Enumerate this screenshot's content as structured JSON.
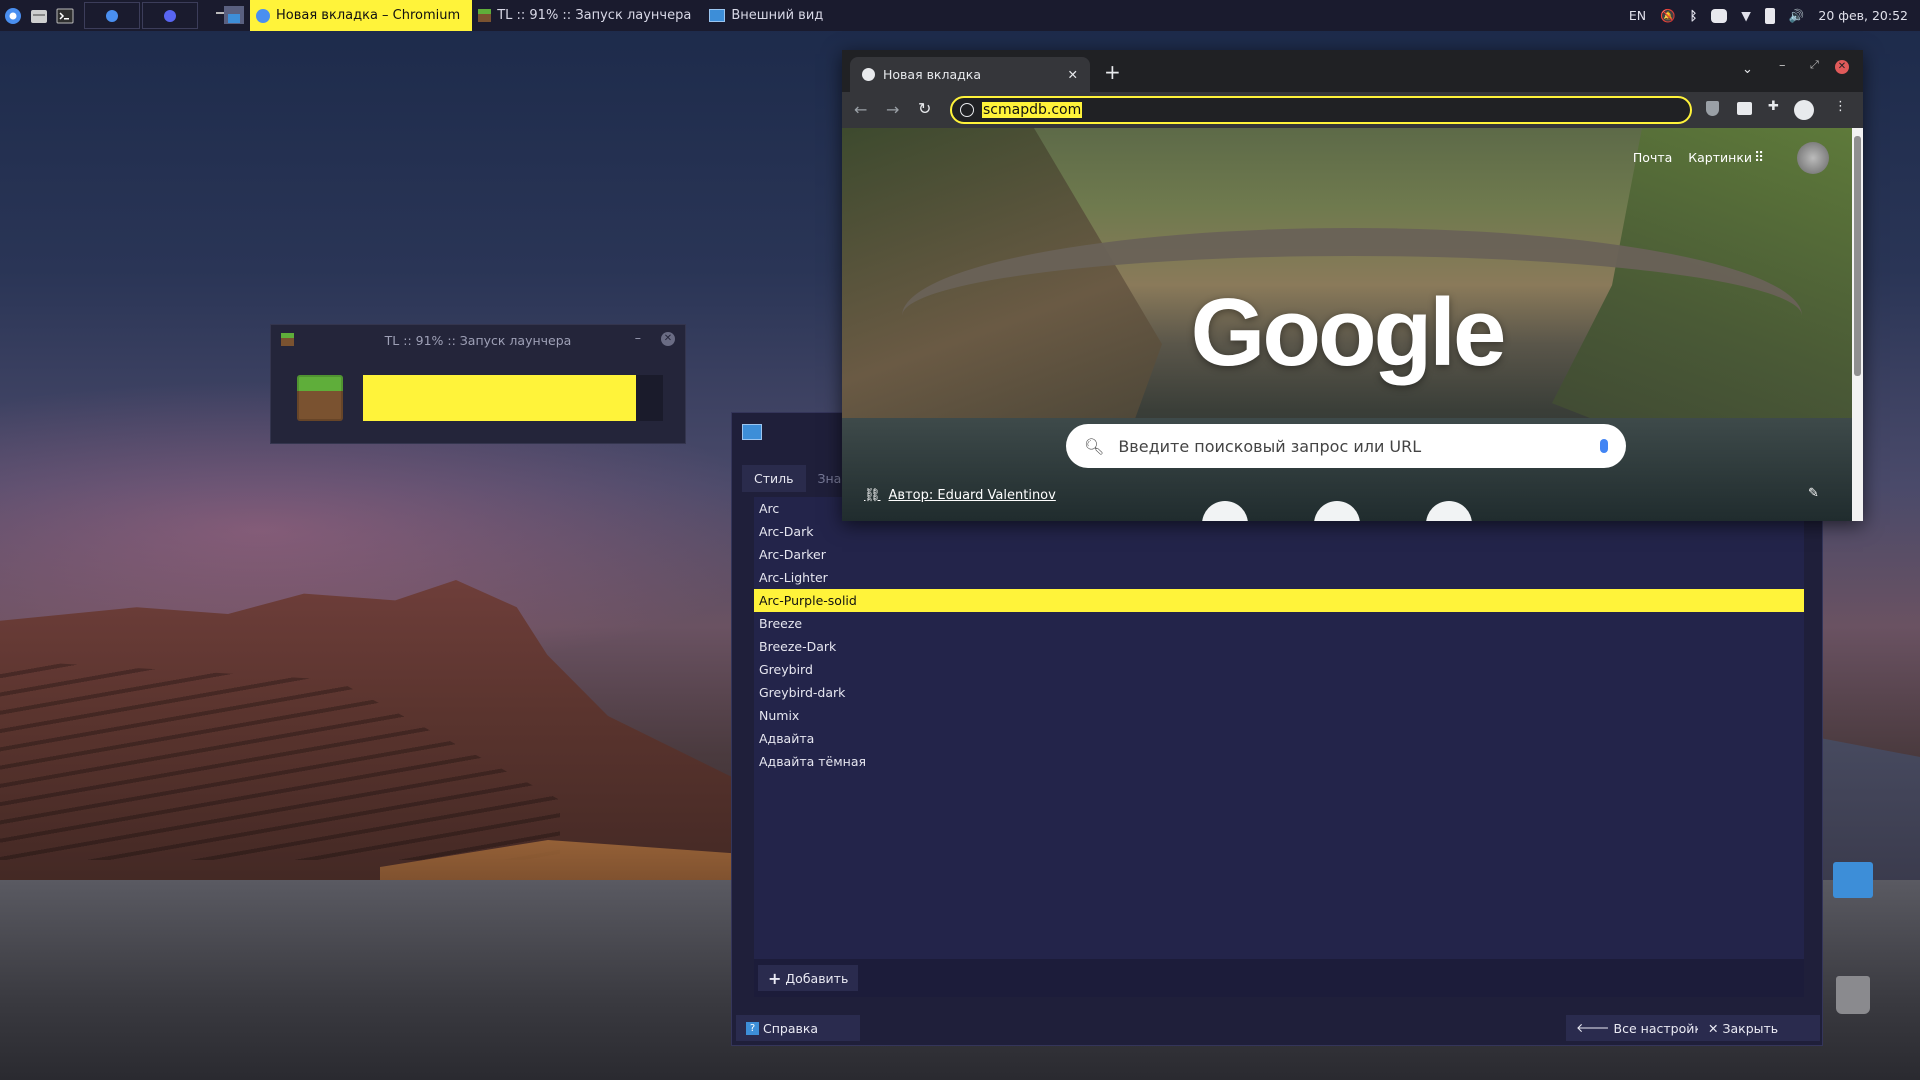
{
  "panel": {
    "tasks": [
      {
        "label": "Новая вкладка – Chromium",
        "active": true
      },
      {
        "label": "TL :: 91% :: Запуск лаунчера",
        "active": false
      },
      {
        "label": "Внешний вид",
        "active": false
      }
    ],
    "tray": {
      "lang": "EN",
      "clock": "20 фев, 20:52"
    }
  },
  "tl_window": {
    "title": "TL :: 91% :: Запуск лаунчера",
    "progress_fraction": 0.91
  },
  "settings": {
    "tabs": [
      {
        "label": "Стиль"
      },
      {
        "label": "Значки"
      }
    ],
    "themes": [
      "Arc",
      "Arc-Dark",
      "Arc-Darker",
      "Arc-Lighter",
      "Arc-Purple-solid",
      "Breeze",
      "Breeze-Dark",
      "Greybird",
      "Greybird-dark",
      "Numix",
      "Адвайта",
      "Адвайта тёмная"
    ],
    "selected": "Arc-Purple-solid",
    "add_label": "Добавить",
    "help_label": "Справка",
    "all_settings_label": "Все настройки",
    "close_label": "Закрыть"
  },
  "chromium": {
    "tab_title": "Новая вкладка",
    "omnibox_value": "scmapdb.com",
    "ntp": {
      "link_mail": "Почта",
      "link_images": "Картинки",
      "logo": "Google",
      "search_placeholder": "Введите поисковый запрос или URL",
      "author": "Автор: Eduard Valentinov"
    }
  },
  "colors": {
    "accent": "#fff33a",
    "panel": "#1a1b2e",
    "window": "#1f1f3a"
  }
}
